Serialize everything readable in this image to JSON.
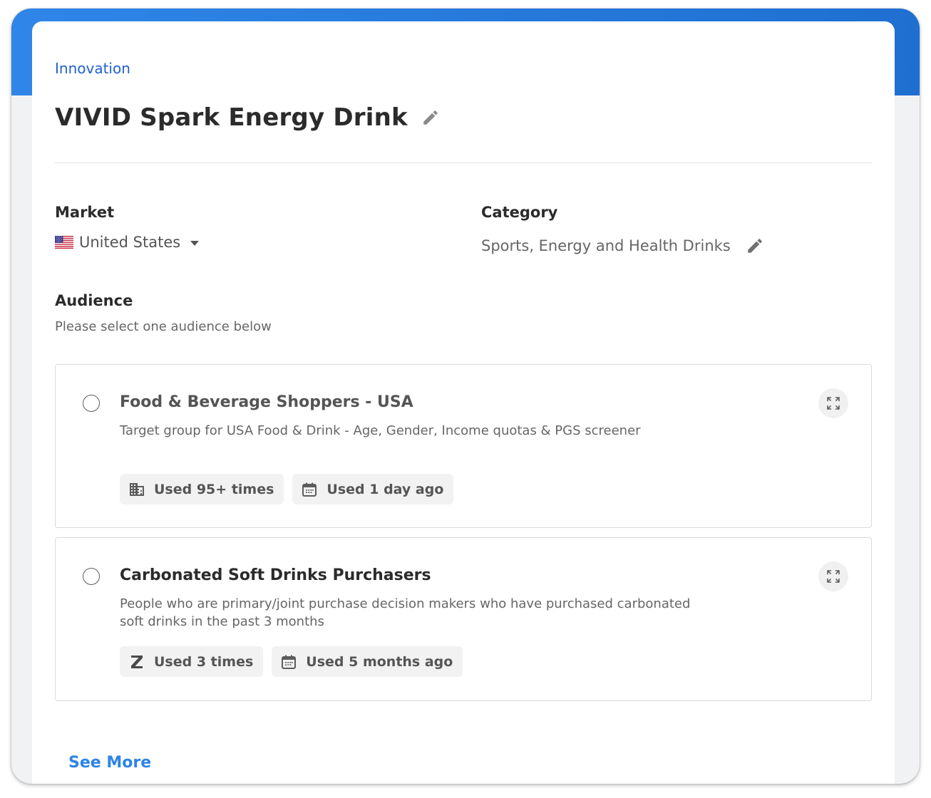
{
  "breadcrumb": "Innovation",
  "project": {
    "title": "VIVID Spark Energy Drink",
    "edit_icon": "pencil-icon"
  },
  "market": {
    "label": "Market",
    "value": "United States",
    "flag": "us-flag-icon",
    "dropdown_icon": "caret-down-icon"
  },
  "category": {
    "label": "Category",
    "value": "Sports, Energy and Health Drinks",
    "edit_icon": "pencil-icon"
  },
  "audience": {
    "label": "Audience",
    "help": "Please select one audience below",
    "items": [
      {
        "name": "Food & Beverage Shoppers - USA",
        "description": "Target group for USA Food & Drink - Age, Gender, Income quotas & PGS screener",
        "selected": false,
        "usage_icon": "building-icon",
        "usage": "Used 95+ times",
        "recency_icon": "calendar-icon",
        "recency": "Used 1 day ago"
      },
      {
        "name": "Carbonated Soft Drinks Purchasers",
        "description": "People who are primary/joint purchase decision makers who have purchased carbonated soft drinks in the past 3 months",
        "selected": false,
        "usage_icon": "z-logo-icon",
        "usage": "Used 3 times",
        "recency_icon": "calendar-icon",
        "recency": "Used 5 months ago"
      }
    ]
  },
  "see_more": "See More",
  "colors": {
    "header_band": "#2f86e8",
    "link": "#1f5fd6",
    "see_more": "#2c84e8",
    "title": "#2b2b2b"
  }
}
